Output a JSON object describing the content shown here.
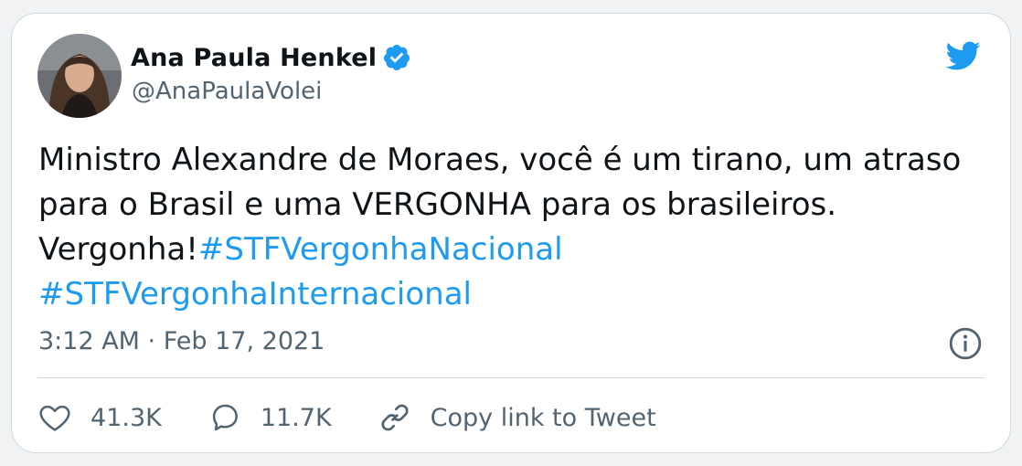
{
  "tweet": {
    "author_name": "Ana Paula Henkel",
    "author_handle": "@AnaPaulaVolei",
    "text_plain": "Ministro Alexandre de Moraes, você é um tirano, um atraso para o Brasil e uma VERGONHA para os brasileiros. Vergonha!",
    "hashtags": [
      "#STFVergonhaNacional",
      "#STFVergonhaInternacional"
    ],
    "timestamp": "3:12 AM · Feb 17, 2021"
  },
  "actions": {
    "like_count": "41.3K",
    "reply_count": "11.7K",
    "copy_link_label": "Copy link to Tweet"
  },
  "icons": {
    "verified": "verified-badge-icon",
    "brand": "twitter-bird-icon",
    "info": "info-icon",
    "like": "heart-icon",
    "reply": "speech-bubble-icon",
    "link": "link-icon"
  },
  "colors": {
    "accent": "#1d9bf0",
    "text_primary": "#0f1419",
    "text_secondary": "#536471",
    "border": "#cfd9de"
  }
}
